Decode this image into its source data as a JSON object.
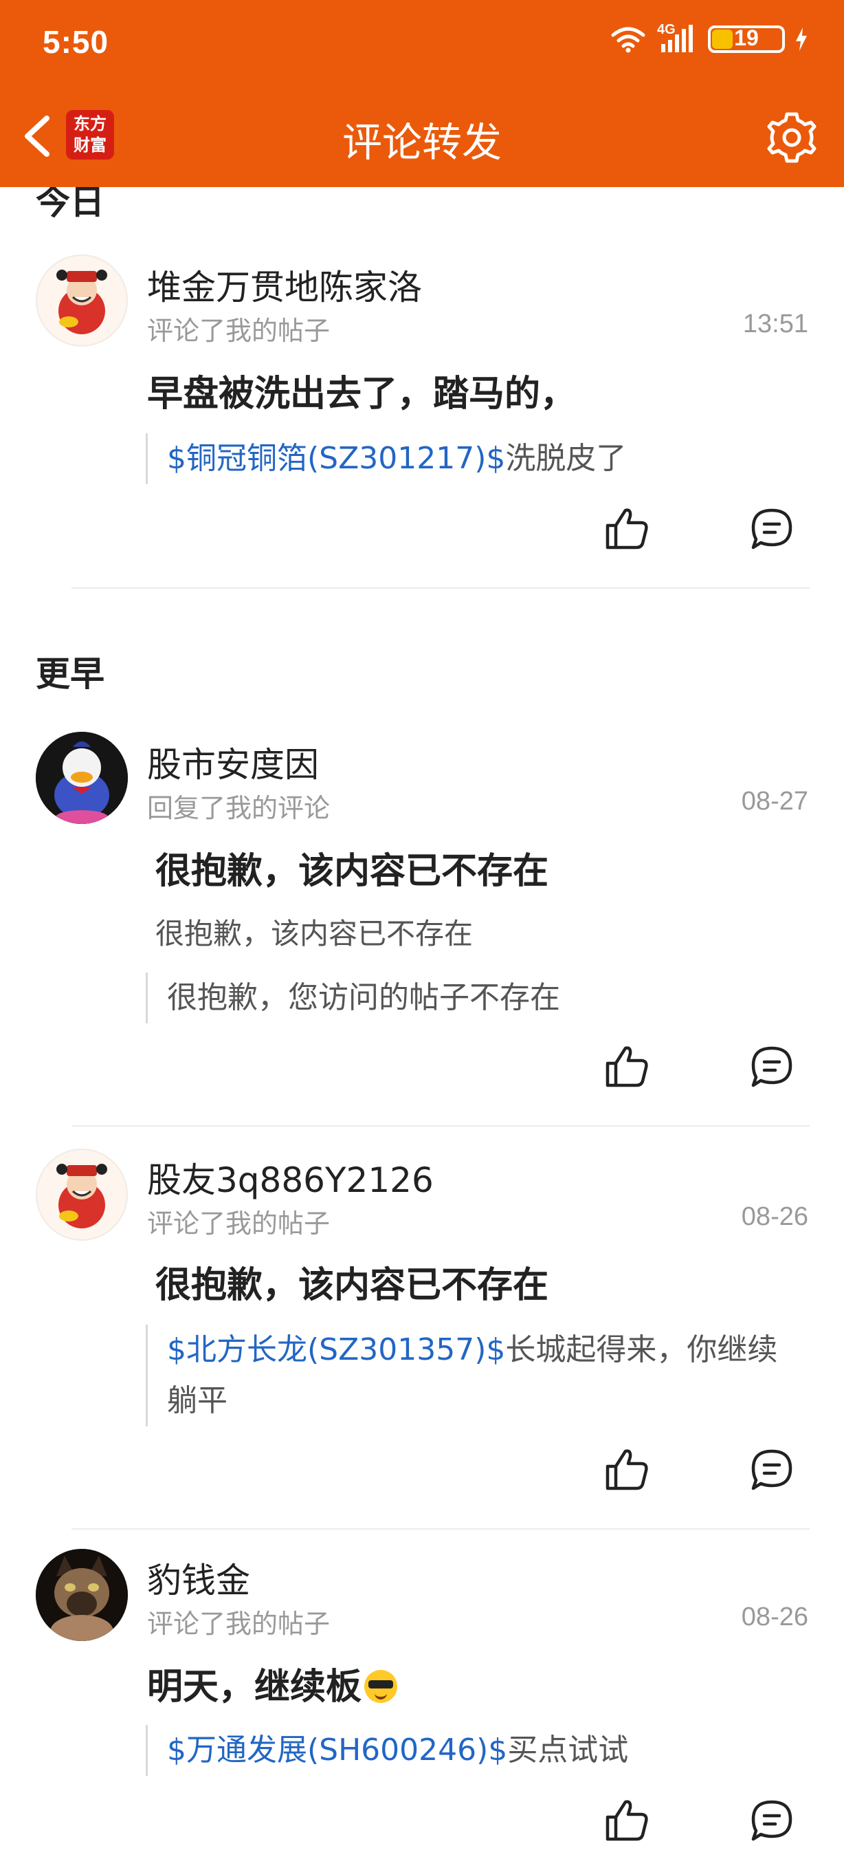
{
  "status_bar": {
    "time": "5:50",
    "network": "4G",
    "battery": "19",
    "battery_level": 0.19
  },
  "header": {
    "logo_line1": "东方",
    "logo_line2": "财富",
    "title": "评论转发"
  },
  "sections": {
    "today": "今日",
    "earlier": "更早"
  },
  "items": [
    {
      "user": "堆金万贯地陈家洛",
      "action": "评论了我的帖子",
      "time": "13:51",
      "comment": "早盘被洗出去了，踏马的，",
      "stock": "$铜冠铜箔(SZ301217)$",
      "quote": "洗脱皮了"
    },
    {
      "user": "股市安度因",
      "action": "回复了我的评论",
      "time": "08-27",
      "comment": "很抱歉，该内容已不存在",
      "sub": "很抱歉，该内容已不存在",
      "quote": "很抱歉，您访问的帖子不存在"
    },
    {
      "user": "股友3q886Y2126",
      "action": "评论了我的帖子",
      "time": "08-26",
      "comment": "很抱歉，该内容已不存在",
      "stock": "$北方长龙(SZ301357)$",
      "quote": "长城起得来，你继续躺平"
    },
    {
      "user": "豹钱金",
      "action": "评论了我的帖子",
      "time": "08-26",
      "comment": "明天，继续板",
      "stock": "$万通发展(SH600246)$",
      "quote": "买点试试"
    }
  ],
  "icons": {
    "back": "chevron-left-icon",
    "settings": "gear-icon",
    "like": "thumbs-up-icon",
    "reply": "comment-icon",
    "emoji": "sunglasses-emoji"
  },
  "colors": {
    "header_bg": "#ea5a0a",
    "link": "#2266c4",
    "muted": "#999999",
    "logo_bg": "#d61f14"
  }
}
